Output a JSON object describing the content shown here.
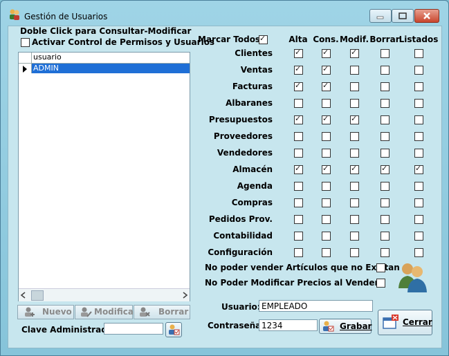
{
  "window": {
    "title": "Gestión de Usuarios"
  },
  "left": {
    "hint": "Doble Click para Consultar-Modificar",
    "activate_label": "Activar Control de Permisos y Usuarios",
    "activate_checked": false,
    "grid_header": "usuario",
    "rows": [
      "ADMIN"
    ]
  },
  "buttons": {
    "nuevo": "Nuevo",
    "modificar": "Modificar",
    "borrar": "Borrar",
    "grabar": "Grabar",
    "cerrar": "Cerrar"
  },
  "admin": {
    "label": "Clave Administrador:",
    "value": ""
  },
  "permissions": {
    "mark_all_label": "Marcar Todos",
    "mark_all_checked": true,
    "columns": [
      "Alta",
      "Cons.",
      "Modif.",
      "Borrar",
      "Listados"
    ],
    "rows": [
      {
        "name": "Clientes",
        "v": [
          1,
          1,
          1,
          0,
          0
        ]
      },
      {
        "name": "Ventas",
        "v": [
          1,
          1,
          0,
          0,
          0
        ]
      },
      {
        "name": "Facturas",
        "v": [
          1,
          1,
          0,
          0,
          0
        ]
      },
      {
        "name": "Albaranes",
        "v": [
          0,
          0,
          0,
          0,
          0
        ]
      },
      {
        "name": "Presupuestos",
        "v": [
          1,
          1,
          1,
          0,
          0
        ]
      },
      {
        "name": "Proveedores",
        "v": [
          0,
          0,
          0,
          0,
          0
        ]
      },
      {
        "name": "Vendedores",
        "v": [
          0,
          0,
          0,
          0,
          0
        ]
      },
      {
        "name": "Almacén",
        "v": [
          1,
          1,
          1,
          1,
          1
        ]
      },
      {
        "name": "Agenda",
        "v": [
          0,
          0,
          0,
          0,
          0
        ]
      },
      {
        "name": "Compras",
        "v": [
          0,
          0,
          0,
          0,
          0
        ]
      },
      {
        "name": "Pedidos Prov.",
        "v": [
          0,
          0,
          0,
          0,
          0
        ]
      },
      {
        "name": "Contabilidad",
        "v": [
          0,
          0,
          0,
          0,
          0
        ]
      },
      {
        "name": "Configuración",
        "v": [
          0,
          0,
          0,
          0,
          0
        ]
      }
    ],
    "extra": [
      {
        "name": "No poder vender Artículos que no Existan",
        "checked": false
      },
      {
        "name": "No Poder Modificar Precios al Vender",
        "checked": false
      }
    ]
  },
  "user": {
    "label": "Usuario:",
    "value": "EMPLEADO"
  },
  "password": {
    "label": "Contraseña:",
    "value": "1234"
  }
}
